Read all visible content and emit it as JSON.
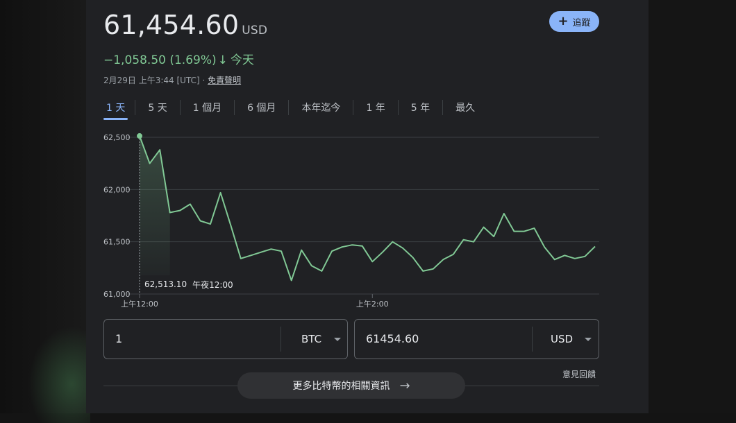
{
  "quote": {
    "price": "61,454.60",
    "currency": "USD",
    "change": "−1,058.50 (1.69%)",
    "change_arrow": "↓",
    "change_period": "今天",
    "timestamp": "2月29日 上午3:44 [UTC] · ",
    "disclaimer": "免責聲明"
  },
  "follow_button": {
    "icon": "plus-icon",
    "label": "追蹤"
  },
  "tabs": [
    {
      "label": "1 天",
      "active": true
    },
    {
      "label": "5 天"
    },
    {
      "label": "1 個月"
    },
    {
      "label": "6 個月"
    },
    {
      "label": "本年迄今"
    },
    {
      "label": "1 年"
    },
    {
      "label": "5 年"
    },
    {
      "label": "最久"
    }
  ],
  "tooltip": {
    "value": "62,513.10",
    "time": "午夜12:00"
  },
  "converter": {
    "from_value": "1",
    "from_unit": "BTC",
    "to_value": "61454.60",
    "to_unit": "USD"
  },
  "feedback_link": "意見回饋",
  "more_button": {
    "label": "更多比特幣的相關資訊",
    "icon": "arrow-right-icon"
  },
  "colors": {
    "line": "#81c995",
    "accent": "#8ab4f8",
    "background": "#202124"
  },
  "chart_data": {
    "type": "line",
    "ytick_labels": [
      "62,500",
      "62,000",
      "61,500",
      "61,000"
    ],
    "ytick_values": [
      62500,
      62000,
      61500,
      61000
    ],
    "ylim": [
      61000,
      62500
    ],
    "xtick_labels": [
      "上午12:00",
      "上午2:00"
    ],
    "grid": true,
    "series": [
      {
        "values": [
          62513,
          62250,
          62380,
          61780,
          61800,
          61860,
          61700,
          61670,
          61970,
          61660,
          61340,
          61370,
          61400,
          61430,
          61410,
          61130,
          61420,
          61270,
          61220,
          61410,
          61450,
          61470,
          61460,
          61310,
          61400,
          61500,
          61440,
          61350,
          61220,
          61240,
          61330,
          61380,
          61520,
          61500,
          61640,
          61550,
          61770,
          61600,
          61600,
          61630,
          61450,
          61330,
          61370,
          61340,
          61360,
          61455
        ]
      }
    ]
  }
}
